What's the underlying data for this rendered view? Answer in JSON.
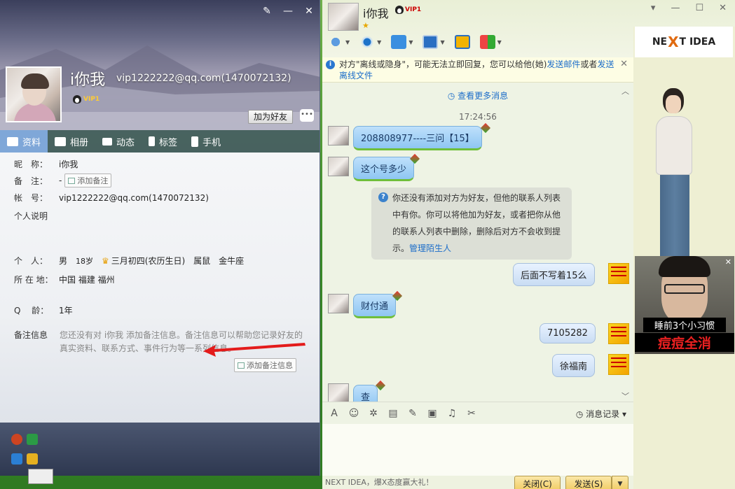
{
  "profile": {
    "name": "i你我",
    "email_line": "vip1222222@qq.com(1470072132)",
    "vip_badge": "VIP1",
    "add_friend": "加为好友",
    "tabs": [
      {
        "label": "资料",
        "icon": "id-card-icon"
      },
      {
        "label": "相册",
        "icon": "photo-album-icon"
      },
      {
        "label": "动态",
        "icon": "feed-list-icon"
      },
      {
        "label": "标签",
        "icon": "bookmark-icon"
      },
      {
        "label": "手机",
        "icon": "mobile-phone-icon"
      }
    ],
    "fields": {
      "nickname_label": "昵　称：",
      "nickname_value": "i你我",
      "remark_label": "备　注：",
      "remark_value": "-",
      "add_remark": "添加备注",
      "account_label": "帐　号：",
      "account_value": "vip1222222@qq.com(1470072132)",
      "signature_label": "个人说明",
      "personal_label": "个　人：",
      "gender": "男",
      "age": "18岁",
      "birthday": "三月初四(农历生日)",
      "zodiac": "属鼠",
      "constellation": "金牛座",
      "location_label": "所 在 地：",
      "location_value": "中国 福建 福州",
      "qage_label": "Q　 龄：",
      "qage_value": "1年",
      "note_label": "备注信息",
      "note_text": "您还没有对 i你我 添加备注信息。备注信息可以帮助您记录好友的真实资料、联系方式、事件行为等一系列信息。",
      "add_note_info": "添加备注信息"
    }
  },
  "chat": {
    "name": "i你我",
    "vip_badge": "VIP1",
    "star": "★",
    "notice": {
      "text1": "对方\"离线或隐身\"，可能无法立即回复，您可以给他(她)",
      "link1": "发送邮件",
      "text2": "或者",
      "link2": "发送离线文件"
    },
    "more_messages": "查看更多消息",
    "timestamp": "17:24:56",
    "messages": [
      {
        "side": "left",
        "text": "208808977----三问【15】"
      },
      {
        "side": "left",
        "text": "这个号多少"
      },
      {
        "side": "right",
        "text": "后面不写着15么"
      },
      {
        "side": "left",
        "text": "财付通"
      },
      {
        "side": "right",
        "text": "7105282"
      },
      {
        "side": "right",
        "text": "徐福南"
      },
      {
        "side": "left",
        "text": "查"
      }
    ],
    "system_msg": {
      "text": "你还没有添加对方为好友，但他的联系人列表中有你。你可以将他加为好友，或者把你从他的联系人列表中删除，删除后对方不会收到提示。",
      "link": "管理陌生人"
    },
    "history": "消息记录",
    "footer_ad": "NEXT IDEA，爆X态度赢大礼！",
    "close_btn": "关闭(C)",
    "send_btn": "发送(S)",
    "side_ad": {
      "logo_left": "NE",
      "logo_x": "X",
      "logo_right": "T IDEA",
      "line1": "睡前3个小习惯",
      "line2": "痘痘全消"
    }
  }
}
